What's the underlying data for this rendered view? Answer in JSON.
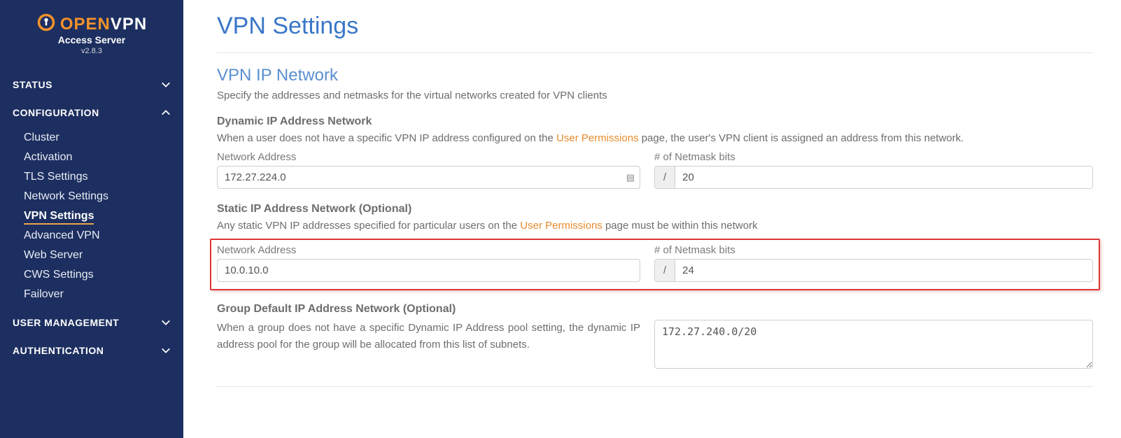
{
  "branding": {
    "open": "OPEN",
    "vpn": "VPN",
    "subtitle": "Access Server",
    "version": "v2.8.3"
  },
  "sidebar": {
    "status": "STATUS",
    "configuration": "CONFIGURATION",
    "config_items": [
      "Cluster",
      "Activation",
      "TLS Settings",
      "Network Settings",
      "VPN Settings",
      "Advanced VPN",
      "Web Server",
      "CWS Settings",
      "Failover"
    ],
    "user_management": "USER  MANAGEMENT",
    "authentication": "AUTHENTICATION"
  },
  "page": {
    "title": "VPN Settings",
    "section_title": "VPN IP Network",
    "section_desc": "Specify the addresses and netmasks for the virtual networks created for VPN clients",
    "dynamic": {
      "title": "Dynamic IP Address Network",
      "desc_pre": "When a user does not have a specific VPN IP address configured on the ",
      "desc_link": "User Permissions",
      "desc_post": " page, the user's VPN client is assigned an address from this network.",
      "net_label": "Network Address",
      "net_value": "172.27.224.0",
      "mask_label": "# of Netmask bits",
      "mask_value": "20"
    },
    "static": {
      "title": "Static IP Address Network (Optional)",
      "desc_pre": "Any static VPN IP addresses specified for particular users on the ",
      "desc_link": "User Permissions",
      "desc_post": " page must be within this network",
      "net_label": "Network Address",
      "net_value": "10.0.10.0",
      "mask_label": "# of Netmask bits",
      "mask_value": "24"
    },
    "group": {
      "title": "Group Default IP Address Network (Optional)",
      "desc": "When a group does not have a specific Dynamic IP Address pool setting, the dynamic IP address pool for the group will be allocated from this list of subnets.",
      "value": "172.27.240.0/20"
    }
  }
}
